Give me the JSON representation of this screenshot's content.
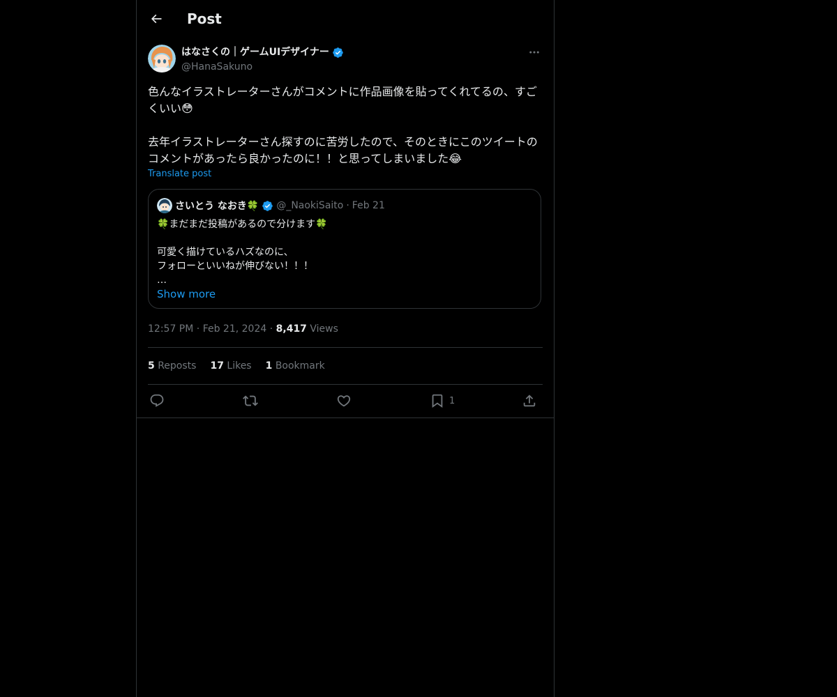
{
  "header": {
    "title": "Post"
  },
  "author": {
    "name": "はなさくの｜ゲームUIデザイナー",
    "handle": "@HanaSakuno",
    "verified": true
  },
  "post": {
    "text": "色んなイラストレーターさんがコメントに作品画像を貼ってくれてるの、すごくいい😳\n\n去年イラストレーターさん探すのに苦労したので、そのときにこのツイートのコメントがあったら良かったのに！！と思ってしまいました😂",
    "translate_label": "Translate post"
  },
  "quote": {
    "name": "さいとう なおき🍀",
    "handle": "@_NaokiSaito",
    "separator": "·",
    "date": "Feb 21",
    "text": "🍀まだまだ投稿があるので分けます🍀\n\n可愛く描けているハズなのに、\nフォローといいねが伸びない！！！\n…",
    "show_more": "Show more"
  },
  "meta": {
    "time": "12:57 PM",
    "sep1": "·",
    "date": "Feb 21, 2024",
    "sep2": "·",
    "views_count": "8,417",
    "views_label": "Views"
  },
  "stats": {
    "reposts_count": "5",
    "reposts_label": "Reposts",
    "likes_count": "17",
    "likes_label": "Likes",
    "bookmarks_count": "1",
    "bookmarks_label": "Bookmark"
  },
  "actions": {
    "bookmark_count": "1"
  },
  "colors": {
    "background": "#000000",
    "text": "#e7e9ea",
    "muted": "#71767b",
    "accent": "#1d9bf0",
    "border": "#2f3336"
  },
  "icons": [
    "back-arrow-icon",
    "more-icon",
    "verified-icon",
    "reply-icon",
    "repost-icon",
    "like-icon",
    "bookmark-icon",
    "share-icon"
  ]
}
